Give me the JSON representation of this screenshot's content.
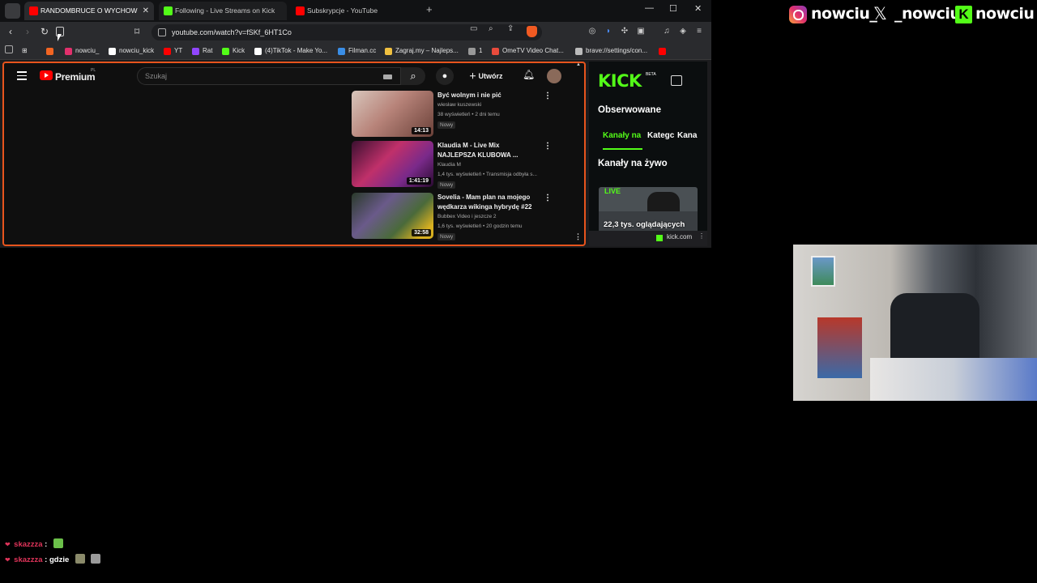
{
  "browser": {
    "tabs": [
      {
        "label": "RANDOMBRUCE O WYCHOW",
        "icon": "youtube-audio-icon",
        "active": true
      },
      {
        "label": "Following - Live Streams on Kick",
        "icon": "kick-icon",
        "active": false
      },
      {
        "label": "Subskrypcje - YouTube",
        "icon": "youtube-icon",
        "active": false
      }
    ],
    "new_tab": "+",
    "window_controls": {
      "minimize": "—",
      "maximize": "☐",
      "close": "✕"
    },
    "url": "youtube.com/watch?v=fSKf_6HT1Co",
    "bookmarks": [
      {
        "label": "",
        "color": "#f26522"
      },
      {
        "label": "nowciu_",
        "color": "#e1306c"
      },
      {
        "label": "nowciu_kick",
        "color": "#ffffff"
      },
      {
        "label": "YT",
        "color": "#ff0000"
      },
      {
        "label": "Rat",
        "color": "#9146ff"
      },
      {
        "label": "Kick",
        "color": "#53fc18"
      },
      {
        "label": "(4)TikTok - Make Yo...",
        "color": "#ffffff"
      },
      {
        "label": "Filman.cc",
        "color": "#3a8ee6"
      },
      {
        "label": "Zagraj.my – Najleps...",
        "color": "#f0c040"
      },
      {
        "label": "1",
        "color": "#999999"
      },
      {
        "label": "OmeTV Video Chat...",
        "color": "#e94b3c"
      },
      {
        "label": "brave://settings/con...",
        "color": "#bbbbbb"
      },
      {
        "label": "",
        "color": "#ff0000"
      }
    ]
  },
  "youtube": {
    "brand": "Premium",
    "region": "PL",
    "search_placeholder": "Szukaj",
    "create_label": "Utwórz",
    "videos": [
      {
        "title": "Być wolnym i nie pić",
        "channel": "wiesław kuszewski",
        "stats": "38 wyświetleń • 2 dni temu",
        "badge": "Nowy",
        "duration": "14:13"
      },
      {
        "title": "Klaudia M - Live Mix NAJLEPSZA KLUBOWA ...",
        "channel": "Klaudia M",
        "stats": "1,4 tys. wyświetleń • Transmisja odbyła s...",
        "badge": "Nowy",
        "duration": "1:41:19"
      },
      {
        "title": "Sovelia - Mam plan na mojego wędkarza wikinga hybrydę #22",
        "channel": "Bubbex Video i jeszcze 2",
        "stats": "1,6 tys. wyświetleń • 20 godzin temu",
        "badge": "Nowy",
        "duration": "32:58"
      }
    ]
  },
  "kick": {
    "logo": "KICK",
    "beta": "BETA",
    "following_title": "Obserwowane",
    "tabs": [
      "Kanały na",
      "Kategc",
      "Kana"
    ],
    "live_title": "Kanały na żywo",
    "live_badge": "LIVE",
    "viewers": "22,3 tys. oglądających",
    "footer_site": "kick.com"
  },
  "overlay": {
    "instagram_handle": "nowciu_",
    "x_handle": "_nowciu",
    "kick_handle": "nowciu"
  },
  "chat": [
    {
      "user": "skazzza",
      "message": ""
    },
    {
      "user": "skazzza",
      "message": "gdzie"
    }
  ]
}
